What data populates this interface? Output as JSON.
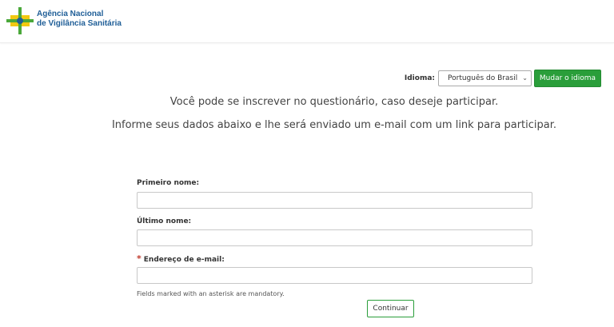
{
  "header": {
    "logo_line1": "Agência Nacional",
    "logo_line2": "de Vigilância Sanitária",
    "colors": {
      "green": "#4aa83a",
      "yellow": "#f2c811",
      "blue": "#1f5e97"
    }
  },
  "language": {
    "label": "Idioma:",
    "selected": "Português do Brasil",
    "button_label": "Mudar o idioma"
  },
  "intro": {
    "line1": "Você pode se inscrever no questionário, caso deseje participar.",
    "line2": "Informe seus dados abaixo e lhe será enviado um e-mail com um link para participar."
  },
  "form": {
    "first_name_label": "Primeiro nome:",
    "first_name_value": "",
    "last_name_label": "Último nome:",
    "last_name_value": "",
    "email_required_marker": "*",
    "email_label": "Endereço de e-mail:",
    "email_value": "",
    "mandatory_note": "Fields marked with an asterisk are mandatory.",
    "continue_label": "Continuar"
  }
}
